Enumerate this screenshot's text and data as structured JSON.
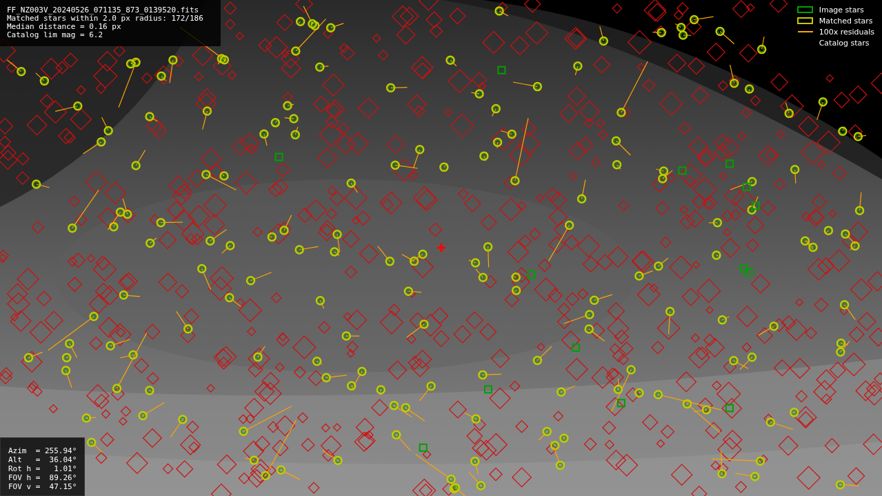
{
  "info": {
    "lines": [
      "FF_NZ003V_20240526_071135_873_0139520.fits",
      "Matched stars within 2.0 px radius: 172/186",
      "Median distance = 0.16 px",
      "Catalog lim mag = 6.2"
    ]
  },
  "legend": {
    "items": [
      {
        "label": "Image stars",
        "kind": "box",
        "color": "#00a000"
      },
      {
        "label": "Matched stars",
        "kind": "box",
        "color": "#c8c800"
      },
      {
        "label": "100x residuals",
        "kind": "line",
        "color": "#ffa500"
      },
      {
        "label": "Catalog stars",
        "kind": "none"
      }
    ]
  },
  "pointing": {
    "lines": [
      "Azim  = 255.94°",
      "Alt   =  36.04°",
      "Rot h =   1.01°",
      "FOV h =  89.26°",
      "FOV v =  47.15°"
    ]
  }
}
